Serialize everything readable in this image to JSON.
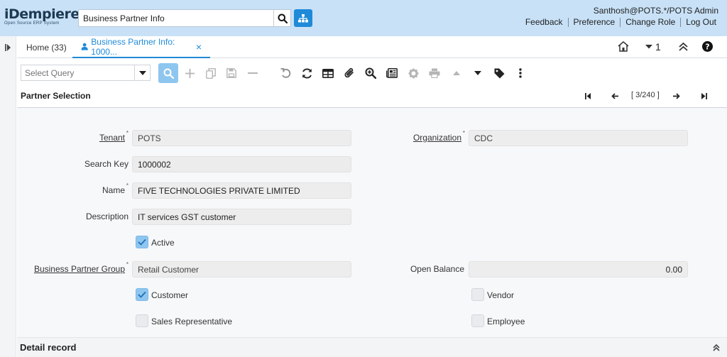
{
  "header": {
    "logo_brand": "iDempiere",
    "logo_tagline": "Open Source ERP System",
    "search_value": "Business Partner Info",
    "user": "Santhosh@POTS.*/POTS Admin",
    "links": [
      "Feedback",
      "Preference",
      "Change Role",
      "Log Out"
    ]
  },
  "tabs": {
    "home": "Home (33)",
    "active": "Business Partner Info: 1000...",
    "close": "×",
    "window_count": "1"
  },
  "toolbar": {
    "query_placeholder": "Select Query"
  },
  "panel": {
    "title": "Partner Selection",
    "record_position": "[ 3/240 ]"
  },
  "form": {
    "tenant_label": "Tenant",
    "tenant_value": "POTS",
    "organization_label": "Organization",
    "organization_value": "CDC",
    "search_key_label": "Search Key",
    "search_key_value": "1000002",
    "name_label": "Name",
    "name_value": "FIVE TECHNOLOGIES PRIVATE LIMITED",
    "description_label": "Description",
    "description_value": "IT services GST customer",
    "active_label": "Active",
    "bp_group_label": "Business Partner Group",
    "bp_group_value": "Retail Customer",
    "open_balance_label": "Open Balance",
    "open_balance_value": "0.00",
    "customer_label": "Customer",
    "vendor_label": "Vendor",
    "sales_rep_label": "Sales Representative",
    "employee_label": "Employee",
    "required_mark": "*"
  },
  "detail": {
    "title": "Detail record"
  },
  "colors": {
    "header_bg": "#c8e1f7",
    "accent": "#1f8ad8",
    "checkbox_on": "#8fc6ef"
  }
}
